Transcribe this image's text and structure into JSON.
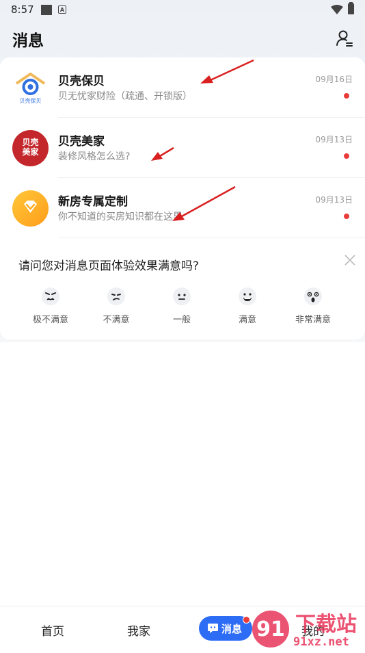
{
  "status_bar": {
    "time": "8:57",
    "notif_letter": "A"
  },
  "header": {
    "title": "消息"
  },
  "messages": [
    {
      "name": "贝壳保贝",
      "preview": "贝无忧家财险（疏通、开锁版）",
      "date": "09月16日",
      "avatar_text": "贝壳保贝",
      "unread": true
    },
    {
      "name": "贝壳美家",
      "preview": "装修风格怎么选?",
      "date": "09月13日",
      "avatar_text_1": "贝壳",
      "avatar_text_2": "美家",
      "unread": true
    },
    {
      "name": "新房专属定制",
      "preview": "你不知道的买房知识都在这里",
      "date": "09月13日",
      "unread": true
    }
  ],
  "survey": {
    "question": "请问您对消息页面体验效果满意吗?",
    "options": [
      {
        "label": "极不满意",
        "icon": "very-dissatisfied-face-icon"
      },
      {
        "label": "不满意",
        "icon": "dissatisfied-face-icon"
      },
      {
        "label": "一般",
        "icon": "neutral-face-icon"
      },
      {
        "label": "满意",
        "icon": "satisfied-face-icon"
      },
      {
        "label": "非常满意",
        "icon": "very-satisfied-face-icon"
      }
    ]
  },
  "bottom_nav": {
    "items": [
      "首页",
      "我家",
      "消息",
      "我的"
    ],
    "active": "消息"
  },
  "watermark": {
    "brand": "下载站",
    "domain": "91xz.net",
    "digits": "91"
  },
  "colors": {
    "accent": "#2d6cf5",
    "badge": "#ea3b3b",
    "arrow": "#d92020"
  }
}
